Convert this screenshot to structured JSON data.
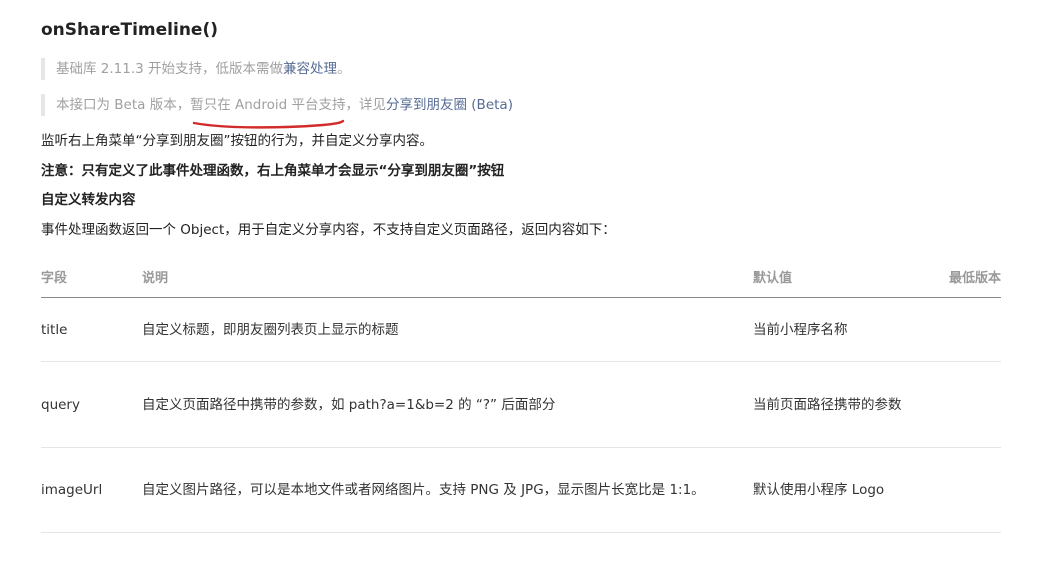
{
  "doc": {
    "title": "onShareTimeline()",
    "note1": {
      "text": "基础库 2.11.3 开始支持，低版本需做",
      "link": "兼容处理",
      "suffix": "。"
    },
    "note2": {
      "text": "本接口为 Beta 版本，暂只在 Android 平台支持，详见",
      "link": "分享到朋友圈 (Beta)"
    },
    "para1": "监听右上角菜单“分享到朋友圈”按钮的行为，并自定义分享内容。",
    "para2": "注意：只有定义了此事件处理函数，右上角菜单才会显示“分享到朋友圈”按钮",
    "para3": "自定义转发内容",
    "para4": "事件处理函数返回一个 Object，用于自定义分享内容，不支持自定义页面路径，返回内容如下：",
    "annotation_color": "#d22b2b"
  },
  "table": {
    "headers": [
      "字段",
      "说明",
      "默认值",
      "最低版本"
    ],
    "rows": [
      {
        "field": "title",
        "desc": "自定义标题，即朋友圈列表页上显示的标题",
        "default": "当前小程序名称",
        "version": ""
      },
      {
        "field": "query",
        "desc": "自定义页面路径中携带的参数，如 path?a=1&b=2 的 “?” 后面部分",
        "default": "当前页面路径携带的参数",
        "version": ""
      },
      {
        "field": "imageUrl",
        "desc": "自定义图片路径，可以是本地文件或者网络图片。支持 PNG 及 JPG，显示图片长宽比是 1:1。",
        "default": "默认使用小程序 Logo",
        "version": ""
      }
    ]
  }
}
